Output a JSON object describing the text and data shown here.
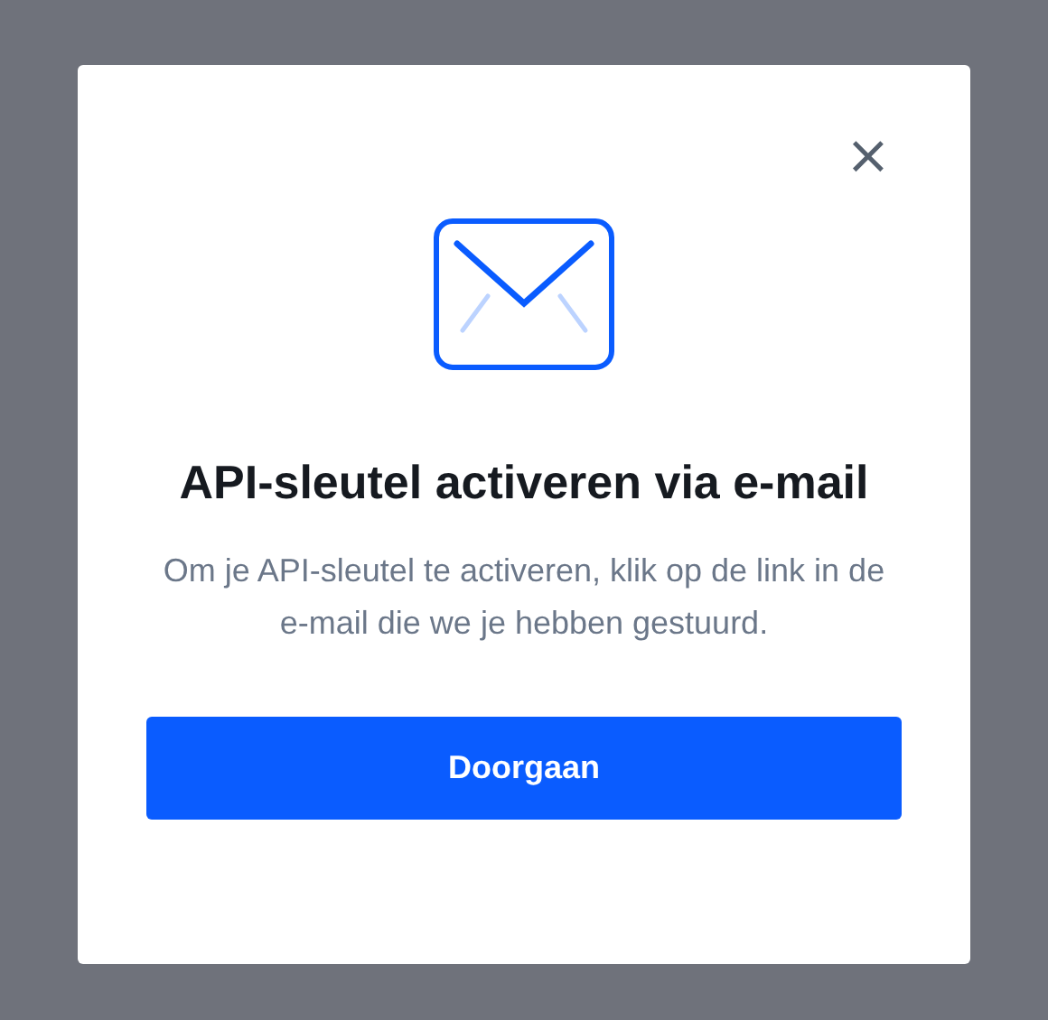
{
  "dialog": {
    "title": "API-sleutel activeren via e-mail",
    "message": "Om je API-sleutel te activeren, klik op de link in de e-mail die we je hebben gestuurd.",
    "button": "Doorgaan",
    "close": "×"
  }
}
